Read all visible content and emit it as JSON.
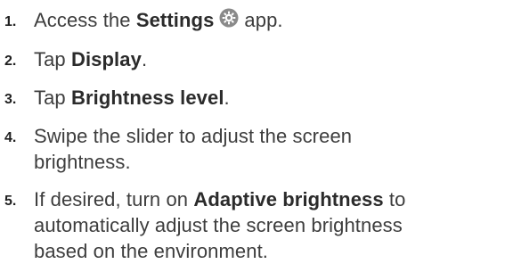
{
  "steps": [
    {
      "number": "1.",
      "before": "Access the ",
      "bold": "Settings",
      "icon": "settings-gear-icon",
      "after": "app."
    },
    {
      "number": "2.",
      "before": "Tap ",
      "bold": "Display",
      "after": "."
    },
    {
      "number": "3.",
      "before": "Tap ",
      "bold": "Brightness level",
      "after": "."
    },
    {
      "number": "4.",
      "line1": "Swipe the slider to adjust the screen",
      "line2": "brightness."
    },
    {
      "number": "5.",
      "before": "If desired, turn on ",
      "bold": "Adaptive brightness",
      "after": " to",
      "line2": "automatically adjust the screen brightness",
      "line3": "based on the environment."
    }
  ],
  "colors": {
    "text": "#3d3d3d",
    "number": "#1f1f1f",
    "icon_bg": "#888888"
  }
}
